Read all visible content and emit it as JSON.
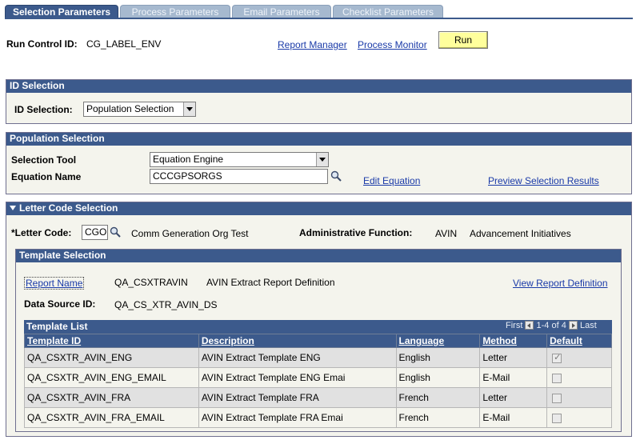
{
  "tabs": [
    {
      "label": "Selection Parameters",
      "active": true
    },
    {
      "label": "Process Parameters",
      "active": false
    },
    {
      "label": "Email Parameters",
      "active": false
    },
    {
      "label": "Checklist Parameters",
      "active": false
    }
  ],
  "header": {
    "run_control_label": "Run Control ID:",
    "run_control_value": "CG_LABEL_ENV",
    "report_manager": "Report Manager",
    "process_monitor": "Process Monitor",
    "run_label": "Run"
  },
  "id_selection": {
    "title": "ID Selection",
    "label": "ID Selection:",
    "value": "Population Selection"
  },
  "population_selection": {
    "title": "Population Selection",
    "tool_label": "Selection Tool",
    "tool_value": "Equation Engine",
    "equation_label": "Equation Name",
    "equation_value": "CCCGPSORGS",
    "edit_equation": "Edit Equation",
    "preview": "Preview Selection Results"
  },
  "letter_code": {
    "title": "Letter Code Selection",
    "label": "*Letter Code:",
    "value": "CGO",
    "description": "Comm Generation Org Test",
    "admin_label": "Administrative Function:",
    "admin_code": "AVIN",
    "admin_desc": "Advancement Initiatives"
  },
  "template_selection": {
    "title": "Template Selection",
    "report_name_label": "Report Name",
    "report_name_value": "QA_CSXTRAVIN",
    "report_name_desc": "AVIN Extract Report Definition",
    "view_report": "View Report Definition",
    "data_source_label": "Data Source ID:",
    "data_source_value": "QA_CS_XTR_AVIN_DS"
  },
  "template_list": {
    "title": "Template List",
    "nav_first": "First",
    "nav_range": "1-4 of 4",
    "nav_last": "Last",
    "columns": [
      "Template ID",
      "Description",
      "Language",
      "Method",
      "Default"
    ],
    "rows": [
      {
        "id": "QA_CSXTR_AVIN_ENG",
        "desc": "AVIN Extract Template ENG",
        "lang": "English",
        "method": "Letter",
        "default": true
      },
      {
        "id": "QA_CSXTR_AVIN_ENG_EMAIL",
        "desc": "AVIN Extract Template ENG Emai",
        "lang": "English",
        "method": "E-Mail",
        "default": false
      },
      {
        "id": "QA_CSXTR_AVIN_FRA",
        "desc": "AVIN Extract Template FRA",
        "lang": "French",
        "method": "Letter",
        "default": false
      },
      {
        "id": "QA_CSXTR_AVIN_FRA_EMAIL",
        "desc": "AVIN Extract Template FRA Emai",
        "lang": "French",
        "method": "E-Mail",
        "default": false
      }
    ]
  },
  "icons": {
    "lookup": "magnifier-icon",
    "dropdown": "chevron-down-icon",
    "collapse": "triangle-down-icon"
  },
  "colors": {
    "header_blue": "#3c5a8c",
    "tab_inactive": "#a6b9cf",
    "run_button": "#ffff9c",
    "link": "#1a3aa8",
    "panel_bg": "#f4f4ed"
  }
}
